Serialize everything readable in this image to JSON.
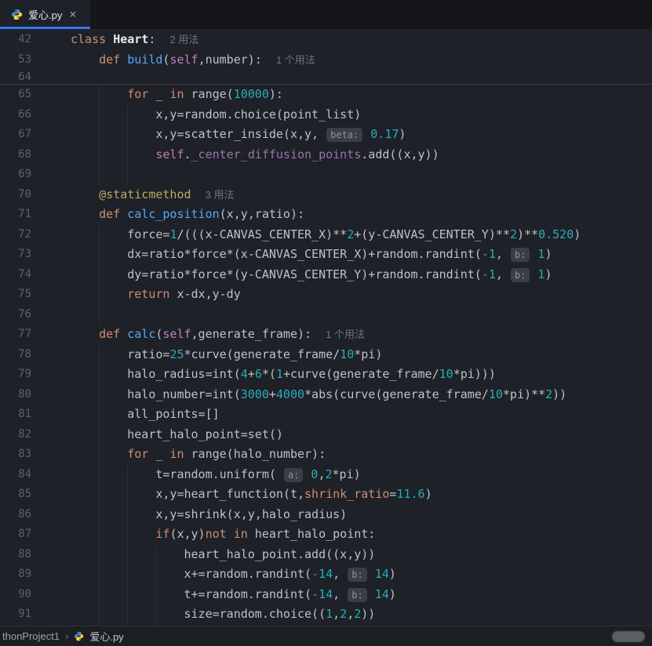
{
  "tab": {
    "title": "爱心.py",
    "close_label": "×"
  },
  "colors": {
    "accent": "#3876F2",
    "editor_bg": "#1E2128",
    "keyword": "#CF8E6D",
    "function": "#57A8F5",
    "number": "#2AACB8",
    "self": "#C77DBB",
    "decorator": "#B3AE60"
  },
  "statusbar": {
    "project": "thonProject1",
    "separator": "›",
    "file": "爱心.py"
  },
  "editor": {
    "sticky_lines": [
      {
        "n": "42",
        "indent": 0,
        "tokens": [
          {
            "t": "class ",
            "c": "kw"
          },
          {
            "t": "Heart",
            "c": "cls"
          },
          {
            "t": ":  ",
            "c": "def"
          },
          {
            "t": "2 用法",
            "c": "usage"
          }
        ]
      },
      {
        "n": "53",
        "indent": 1,
        "tokens": [
          {
            "t": "def ",
            "c": "kw"
          },
          {
            "t": "build",
            "c": "fn"
          },
          {
            "t": "(",
            "c": "def"
          },
          {
            "t": "self",
            "c": "self"
          },
          {
            "t": ",number):  ",
            "c": "def"
          },
          {
            "t": "1 个用法",
            "c": "usage"
          }
        ]
      }
    ],
    "partial_line": {
      "n": "64",
      "indent": 0,
      "tokens": []
    },
    "lines": [
      {
        "n": "65",
        "indent": 2,
        "tokens": [
          {
            "t": "for",
            "c": "kw"
          },
          {
            "t": " _ ",
            "c": "def"
          },
          {
            "t": "in",
            "c": "kw"
          },
          {
            "t": " range(",
            "c": "def"
          },
          {
            "t": "10000",
            "c": "num"
          },
          {
            "t": "):",
            "c": "def"
          }
        ]
      },
      {
        "n": "66",
        "indent": 3,
        "tokens": [
          {
            "t": "x,y=random.choice(point_list)",
            "c": "def"
          }
        ]
      },
      {
        "n": "67",
        "indent": 3,
        "tokens": [
          {
            "t": "x,y=scatter_inside(x,y, ",
            "c": "def"
          },
          {
            "t": "beta:",
            "c": "pill"
          },
          {
            "t": " ",
            "c": "def"
          },
          {
            "t": "0.17",
            "c": "num"
          },
          {
            "t": ")",
            "c": "def"
          }
        ]
      },
      {
        "n": "68",
        "indent": 3,
        "tokens": [
          {
            "t": "self",
            "c": "self"
          },
          {
            "t": ".",
            "c": "def"
          },
          {
            "t": "_center_diffusion_points",
            "c": "attr"
          },
          {
            "t": ".add((x,y))",
            "c": "def"
          }
        ]
      },
      {
        "n": "69",
        "indent": 3,
        "tokens": []
      },
      {
        "n": "70",
        "indent": 1,
        "tokens": [
          {
            "t": "@staticmethod",
            "c": "deco"
          },
          {
            "t": "  ",
            "c": "def"
          },
          {
            "t": "3 用法",
            "c": "usage"
          }
        ]
      },
      {
        "n": "71",
        "indent": 1,
        "tokens": [
          {
            "t": "def ",
            "c": "kw"
          },
          {
            "t": "calc_position",
            "c": "fn"
          },
          {
            "t": "(x,y,ratio):",
            "c": "def"
          }
        ]
      },
      {
        "n": "72",
        "indent": 2,
        "tokens": [
          {
            "t": "force=",
            "c": "def"
          },
          {
            "t": "1",
            "c": "num"
          },
          {
            "t": "/(((x-CANVAS_CENTER_X)**",
            "c": "def"
          },
          {
            "t": "2",
            "c": "num"
          },
          {
            "t": "+(y-CANVAS_CENTER_Y)**",
            "c": "def"
          },
          {
            "t": "2",
            "c": "num"
          },
          {
            "t": ")**",
            "c": "def"
          },
          {
            "t": "0.520",
            "c": "num"
          },
          {
            "t": ")",
            "c": "def"
          }
        ]
      },
      {
        "n": "73",
        "indent": 2,
        "tokens": [
          {
            "t": "dx=ratio*force*(x-CANVAS_CENTER_X)+random.randint(",
            "c": "def"
          },
          {
            "t": "-1",
            "c": "num"
          },
          {
            "t": ", ",
            "c": "def"
          },
          {
            "t": "b:",
            "c": "pill"
          },
          {
            "t": " ",
            "c": "def"
          },
          {
            "t": "1",
            "c": "num"
          },
          {
            "t": ")",
            "c": "def"
          }
        ]
      },
      {
        "n": "74",
        "indent": 2,
        "tokens": [
          {
            "t": "dy=ratio*force*(y-CANVAS_CENTER_Y)+random.randint(",
            "c": "def"
          },
          {
            "t": "-1",
            "c": "num"
          },
          {
            "t": ", ",
            "c": "def"
          },
          {
            "t": "b:",
            "c": "pill"
          },
          {
            "t": " ",
            "c": "def"
          },
          {
            "t": "1",
            "c": "num"
          },
          {
            "t": ")",
            "c": "def"
          }
        ]
      },
      {
        "n": "75",
        "indent": 2,
        "tokens": [
          {
            "t": "return",
            "c": "kw"
          },
          {
            "t": " x-dx,y-dy",
            "c": "def"
          }
        ]
      },
      {
        "n": "76",
        "indent": 2,
        "tokens": []
      },
      {
        "n": "77",
        "indent": 1,
        "tokens": [
          {
            "t": "def ",
            "c": "kw"
          },
          {
            "t": "calc",
            "c": "fn"
          },
          {
            "t": "(",
            "c": "def"
          },
          {
            "t": "self",
            "c": "self"
          },
          {
            "t": ",generate_frame):  ",
            "c": "def"
          },
          {
            "t": "1 个用法",
            "c": "usage"
          }
        ]
      },
      {
        "n": "78",
        "indent": 2,
        "tokens": [
          {
            "t": "ratio=",
            "c": "def"
          },
          {
            "t": "25",
            "c": "num"
          },
          {
            "t": "*curve(generate_frame/",
            "c": "def"
          },
          {
            "t": "10",
            "c": "num"
          },
          {
            "t": "*pi)",
            "c": "def"
          }
        ]
      },
      {
        "n": "79",
        "indent": 2,
        "tokens": [
          {
            "t": "halo_radius=int(",
            "c": "def"
          },
          {
            "t": "4",
            "c": "num"
          },
          {
            "t": "+",
            "c": "def"
          },
          {
            "t": "6",
            "c": "num"
          },
          {
            "t": "*(",
            "c": "def"
          },
          {
            "t": "1",
            "c": "num"
          },
          {
            "t": "+curve(generate_frame/",
            "c": "def"
          },
          {
            "t": "10",
            "c": "num"
          },
          {
            "t": "*pi)))",
            "c": "def"
          }
        ]
      },
      {
        "n": "80",
        "indent": 2,
        "tokens": [
          {
            "t": "halo_number=int(",
            "c": "def"
          },
          {
            "t": "3000",
            "c": "num"
          },
          {
            "t": "+",
            "c": "def"
          },
          {
            "t": "4000",
            "c": "num"
          },
          {
            "t": "*abs(curve(generate_frame/",
            "c": "def"
          },
          {
            "t": "10",
            "c": "num"
          },
          {
            "t": "*pi)**",
            "c": "def"
          },
          {
            "t": "2",
            "c": "num"
          },
          {
            "t": "))",
            "c": "def"
          }
        ]
      },
      {
        "n": "81",
        "indent": 2,
        "tokens": [
          {
            "t": "all_points=[]",
            "c": "def"
          }
        ]
      },
      {
        "n": "82",
        "indent": 2,
        "tokens": [
          {
            "t": "heart_halo_point=set()",
            "c": "def"
          }
        ]
      },
      {
        "n": "83",
        "indent": 2,
        "tokens": [
          {
            "t": "for",
            "c": "kw"
          },
          {
            "t": " _ ",
            "c": "def"
          },
          {
            "t": "in",
            "c": "kw"
          },
          {
            "t": " range(halo_number):",
            "c": "def"
          }
        ]
      },
      {
        "n": "84",
        "indent": 3,
        "tokens": [
          {
            "t": "t=random.uniform( ",
            "c": "def"
          },
          {
            "t": "a:",
            "c": "pill"
          },
          {
            "t": " ",
            "c": "def"
          },
          {
            "t": "0",
            "c": "num"
          },
          {
            "t": ",",
            "c": "def"
          },
          {
            "t": "2",
            "c": "num"
          },
          {
            "t": "*pi)",
            "c": "def"
          }
        ]
      },
      {
        "n": "85",
        "indent": 3,
        "tokens": [
          {
            "t": "x,y=heart_function(t,",
            "c": "def"
          },
          {
            "t": "shrink_ratio",
            "c": "named"
          },
          {
            "t": "=",
            "c": "def"
          },
          {
            "t": "11.6",
            "c": "num"
          },
          {
            "t": ")",
            "c": "def"
          }
        ]
      },
      {
        "n": "86",
        "indent": 3,
        "tokens": [
          {
            "t": "x,y=shrink(x,y,halo_radius)",
            "c": "def"
          }
        ]
      },
      {
        "n": "87",
        "indent": 3,
        "tokens": [
          {
            "t": "if",
            "c": "kw"
          },
          {
            "t": "(x,y)",
            "c": "def"
          },
          {
            "t": "not",
            "c": "kw"
          },
          {
            "t": " ",
            "c": "def"
          },
          {
            "t": "in",
            "c": "kw"
          },
          {
            "t": " heart_halo_point:",
            "c": "def"
          }
        ]
      },
      {
        "n": "88",
        "indent": 4,
        "tokens": [
          {
            "t": "heart_halo_point.add((x,y))",
            "c": "def"
          }
        ]
      },
      {
        "n": "89",
        "indent": 4,
        "tokens": [
          {
            "t": "x+=random.randint(",
            "c": "def"
          },
          {
            "t": "-14",
            "c": "num"
          },
          {
            "t": ", ",
            "c": "def"
          },
          {
            "t": "b:",
            "c": "pill"
          },
          {
            "t": " ",
            "c": "def"
          },
          {
            "t": "14",
            "c": "num"
          },
          {
            "t": ")",
            "c": "def"
          }
        ]
      },
      {
        "n": "90",
        "indent": 4,
        "tokens": [
          {
            "t": "t+=random.randint(",
            "c": "def"
          },
          {
            "t": "-14",
            "c": "num"
          },
          {
            "t": ", ",
            "c": "def"
          },
          {
            "t": "b:",
            "c": "pill"
          },
          {
            "t": " ",
            "c": "def"
          },
          {
            "t": "14",
            "c": "num"
          },
          {
            "t": ")",
            "c": "def"
          }
        ]
      },
      {
        "n": "91",
        "indent": 4,
        "tokens": [
          {
            "t": "size=random.choice((",
            "c": "def"
          },
          {
            "t": "1",
            "c": "num"
          },
          {
            "t": ",",
            "c": "def"
          },
          {
            "t": "2",
            "c": "num"
          },
          {
            "t": ",",
            "c": "def"
          },
          {
            "t": "2",
            "c": "num"
          },
          {
            "t": "))",
            "c": "def"
          }
        ]
      }
    ]
  }
}
